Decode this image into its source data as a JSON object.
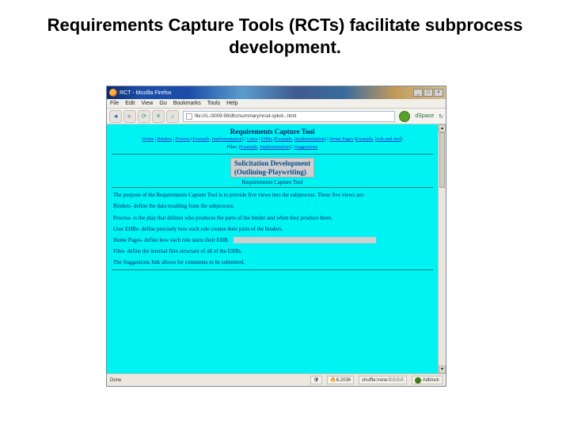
{
  "slide": {
    "title": "Requirements Capture Tools (RCTs) facilitate subprocess development."
  },
  "window": {
    "title": "RCT - Mozilla Firefox",
    "min": "_",
    "max": "□",
    "close": "×"
  },
  "menubar": [
    "File",
    "Edit",
    "View",
    "Go",
    "Bookmarks",
    "Tools",
    "Help"
  ],
  "toolbar": {
    "address": "file:///L:/3009-99/dfcr/summary/ncsd-spk/d...html",
    "right_label": "dSpace"
  },
  "page": {
    "heading": "Requirements Capture Tool",
    "nav": {
      "home": "Home",
      "binders": "Binders",
      "process": "Process",
      "users": "Users",
      "ehbs": "EHBs",
      "homepages": "Home Pages",
      "example": "Example",
      "implementation": "Implementation",
      "lookandfeel": "look-and-feel"
    },
    "nav_sep": " | ",
    "files_label": "Files: ",
    "files_links": {
      "a": "Example",
      "b": "Implementation"
    },
    "files_sep": " | ",
    "suggestions": "Suggestions",
    "highlight1": "Solicitation Development",
    "highlight2": "(Outlining-Playwriting)",
    "subcaption": "Requirements Capture Tool",
    "intro": "The purpose of the Requirements Capture Tool is to provide five views into the subprocess. These five views are:",
    "bullets": {
      "binders": "Binders- define the data resulting from the subprocess.",
      "process": "Process- is the play that defines who produces the parts of the binder and when they produce them.",
      "userehbs": "User EHBs- define precisely how each role creates their parts of the binders.",
      "homepages": "Home Pages- define how each role starts their EHB.",
      "files": "Files- define the internal files structure of all of the EHBs."
    },
    "closing": "The Suggestions link allows for comments to be submitted."
  },
  "status": {
    "done": "Done",
    "shield": "🛡",
    "blocker": "6.2036",
    "proxy": "shuffle:none:0.0.0.0",
    "zone": "Adblock"
  }
}
